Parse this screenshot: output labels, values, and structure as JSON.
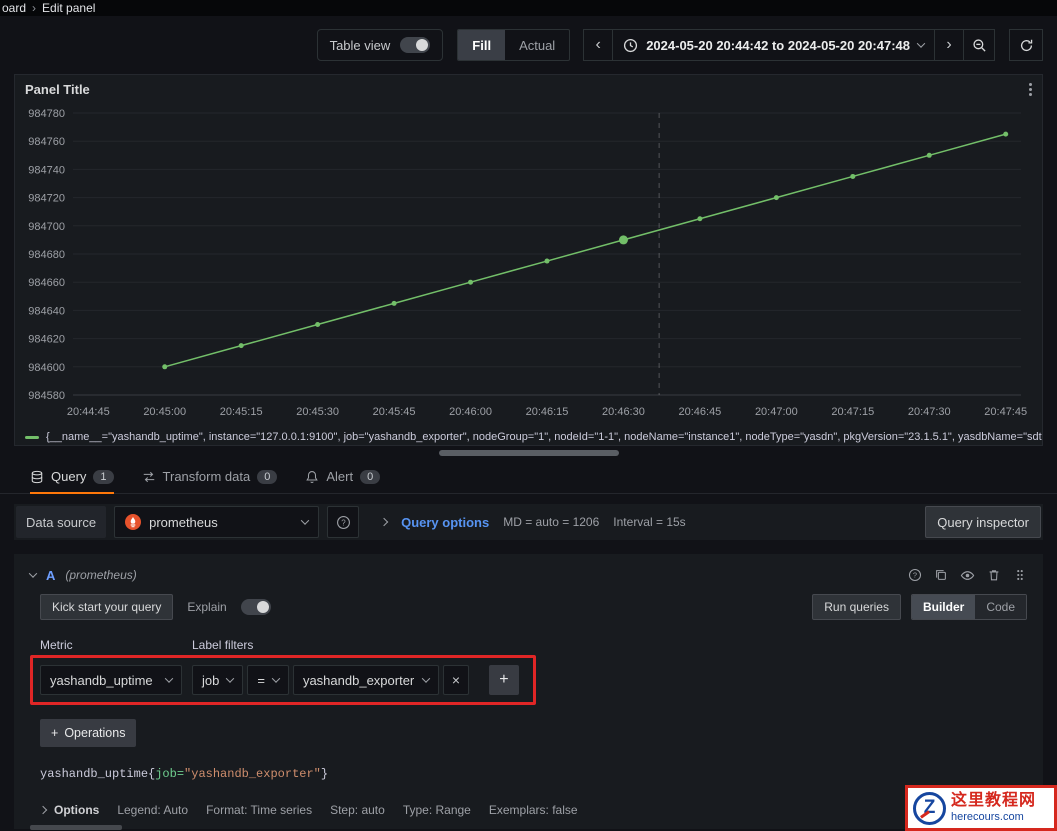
{
  "colors": {
    "page_bg": "#111217",
    "panel_bg": "#181b1f",
    "series_green": "#73bf69",
    "link_blue": "#5794f2",
    "tab_underline_orange": "#ff780a",
    "highlight_red": "#e02626",
    "prometheus_orange": "#e6522c",
    "watermark_red": "#d5281e",
    "watermark_blue": "#16469f"
  },
  "breadcrumb": {
    "parent": "oard",
    "separator": "›",
    "current": "Edit panel"
  },
  "toolbar": {
    "table_view_label": "Table view",
    "fill_label": "Fill",
    "actual_label": "Actual",
    "prev_symbol": "‹",
    "next_symbol": "›",
    "time_range": "2024-05-20 20:44:42 to 2024-05-20 20:47:48"
  },
  "panel": {
    "title": "Panel Title"
  },
  "chart_data": {
    "type": "line",
    "title": "Panel Title",
    "x_start": "20:44:42",
    "x_end": "20:47:48",
    "x_ticks": [
      "20:44:45",
      "20:45:00",
      "20:45:15",
      "20:45:30",
      "20:45:45",
      "20:46:00",
      "20:46:15",
      "20:46:30",
      "20:46:45",
      "20:47:00",
      "20:47:15",
      "20:47:30",
      "20:47:45"
    ],
    "y_ticks": [
      984580,
      984600,
      984620,
      984640,
      984660,
      984680,
      984700,
      984720,
      984740,
      984760,
      984780
    ],
    "ylim": [
      984580,
      984780
    ],
    "grid": true,
    "legend_position": "bottom",
    "series": [
      {
        "name": "yashandb_uptime{job=\"yashandb_exporter\"}",
        "color": "#73bf69",
        "x": [
          "20:45:00",
          "20:45:15",
          "20:45:30",
          "20:45:45",
          "20:46:00",
          "20:46:15",
          "20:46:30",
          "20:46:45",
          "20:47:00",
          "20:47:15",
          "20:47:30",
          "20:47:45"
        ],
        "values": [
          984600,
          984615,
          984630,
          984645,
          984660,
          984675,
          984690,
          984705,
          984720,
          984735,
          984750,
          984765
        ]
      }
    ],
    "highlight_index": 6,
    "crosshair_time": "20:46:37"
  },
  "legend": {
    "series_text": "{__name__=\"yashandb_uptime\", instance=\"127.0.0.1:9100\", job=\"yashandb_exporter\", nodeGroup=\"1\", nodeId=\"1-1\", nodeName=\"instance1\", nodeType=\"yasdn\", pkgVersion=\"23.1.5.1\", yasdbName=\"sdt"
  },
  "tabs": [
    {
      "label": "Query",
      "badge": "1"
    },
    {
      "label": "Transform data",
      "badge": "0"
    },
    {
      "label": "Alert",
      "badge": "0"
    }
  ],
  "datasource_row": {
    "label": "Data source",
    "selected": "prometheus",
    "query_options_label": "Query options",
    "max_data_points": "MD = auto = 1206",
    "interval": "Interval = 15s",
    "inspector_button": "Query inspector"
  },
  "query_editor": {
    "ref_id": "A",
    "datasource_hint": "(prometheus)",
    "kick_start_button": "Kick start your query",
    "explain_label": "Explain",
    "run_queries_button": "Run queries",
    "builder_tab": "Builder",
    "code_tab": "Code",
    "metric_label": "Metric",
    "label_filters_label": "Label filters",
    "metric_value": "yashandb_uptime",
    "filter_label": "job",
    "filter_operator": "=",
    "filter_value": "yashandb_exporter",
    "remove_filter_symbol": "×",
    "add_filter_symbol": "+",
    "operations_plus": "+",
    "operations_label": "Operations",
    "query_preview": {
      "metric": "yashandb_uptime",
      "open_brace": "{",
      "label_eq": "job=",
      "value": "\"yashandb_exporter\"",
      "close_brace": "}"
    },
    "options_row": {
      "label": "Options",
      "legend": "Legend: Auto",
      "format": "Format: Time series",
      "step": "Step: auto",
      "type": "Type: Range",
      "exemplars": "Exemplars: false"
    }
  },
  "watermark": {
    "site_name": "这里教程网",
    "site_url": "herecours.com",
    "logo_letter": "Z"
  }
}
